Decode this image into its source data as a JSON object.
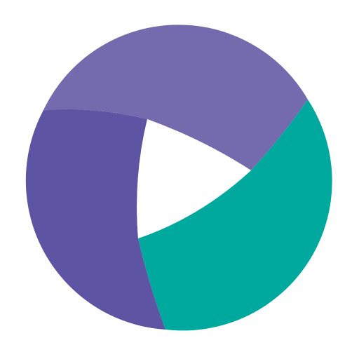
{
  "logo": {
    "icon": "circular-play-logo-icon",
    "colors": {
      "top_segment": "#736bad",
      "left_segment": "#5d54a4",
      "right_segment": "#00a99d",
      "center_triangle": "#ffffff",
      "background": "#ffffff"
    }
  }
}
